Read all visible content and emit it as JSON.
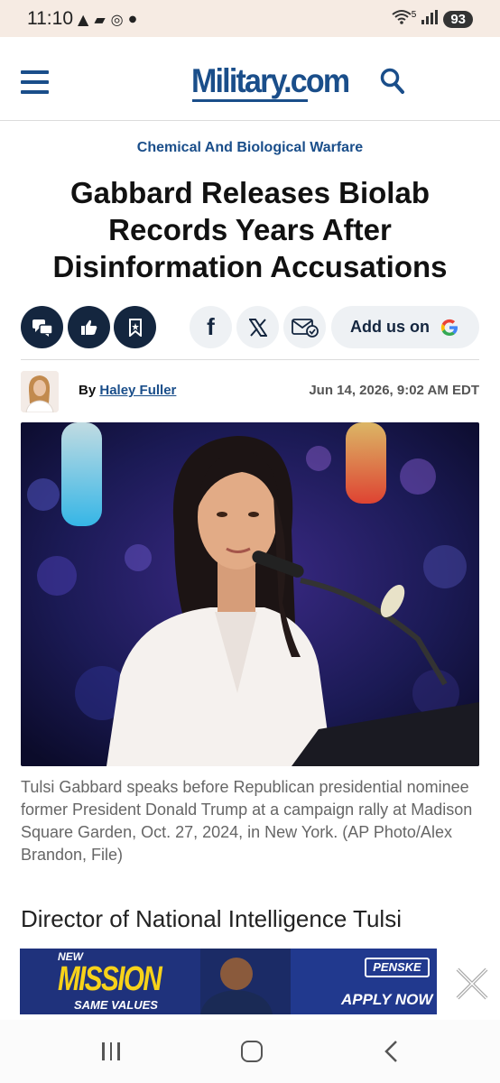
{
  "status_bar": {
    "time": "11:10",
    "left_icons": [
      "warning-icon",
      "bookmark-icon",
      "chrome-icon",
      "dot-icon"
    ],
    "battery": "93",
    "wifi_label": "5",
    "signal_icon": "signal-icon"
  },
  "header": {
    "logo_text": "Military.com",
    "menu_icon": "hamburger-icon",
    "search_icon": "search-icon",
    "brand_color": "#1a4e8a"
  },
  "article": {
    "category": "Chemical And Biological Warfare",
    "headline": "Gabbard Releases Biolab Records Years After Disinformation Accusations",
    "share": {
      "buttons": [
        "comments-icon",
        "like-icon",
        "bookmark-icon",
        "facebook-icon",
        "x-icon",
        "email-icon"
      ],
      "add_us_label": "Add us on",
      "google_icon": "google-icon"
    },
    "byline": {
      "prefix": "By",
      "author": "Haley Fuller",
      "date": "Jun 14, 2026, 9:02 AM EDT"
    },
    "image_caption": "Tulsi Gabbard speaks before Republican presidential nominee former President Donald Trump at a campaign rally at Madison Square Garden, Oct. 27, 2024, in New York. (AP Photo/Alex Brandon, File)",
    "lead_text": "Director of National Intelligence Tulsi"
  },
  "ad": {
    "new_label": "NEW",
    "mission_label": "MISSION",
    "values_label": "SAME VALUES",
    "brand": "PENSKE",
    "cta": "APPLY NOW",
    "close_icon": "close-icon"
  },
  "nav_bar": {
    "buttons": [
      "recents-icon",
      "home-icon",
      "back-icon"
    ]
  }
}
